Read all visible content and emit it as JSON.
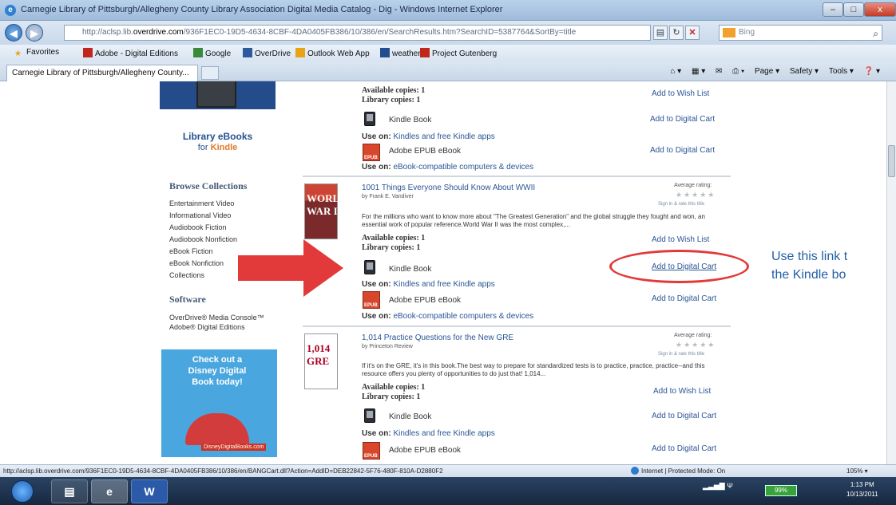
{
  "window": {
    "title": "Carnegie Library of Pittsburgh/Allegheny County Library Association Digital Media Catalog - Dig - Windows Internet Explorer",
    "minimize": "–",
    "maximize": "□",
    "close": "x"
  },
  "addressbar": {
    "url_prefix": "http://aclsp.lib.",
    "url_domain": "overdrive.com",
    "url_rest": "/936F1EC0-19D5-4634-8CBF-4DA0405FB386/10/386/en/SearchResults.htm?SearchID=5387764&SortBy=title",
    "search_placeholder": "Bing"
  },
  "favorites": {
    "label": "Favorites",
    "items": [
      "Adobe - Digital Editions",
      "Google",
      "OverDrive",
      "Outlook Web App",
      "weather",
      "Project Gutenberg"
    ]
  },
  "tab": {
    "label": "Carnegie Library of Pittsburgh/Allegheny County..."
  },
  "commandbar": {
    "page": "Page ▾",
    "safety": "Safety ▾",
    "tools": "Tools ▾"
  },
  "sidebar": {
    "kindle_ad": {
      "line1": "Library eBooks",
      "line2_prefix": "for",
      "line2_brand": "Kindle"
    },
    "browse_heading": "Browse Collections",
    "collections": [
      "Entertainment Video",
      "Informational Video",
      "Audiobook Fiction",
      "Audiobook Nonfiction",
      "eBook Fiction",
      "eBook Nonfiction",
      "Collections"
    ],
    "software_heading": "Software",
    "software": [
      "OverDrive® Media Console™",
      "Adobe® Digital Editions"
    ],
    "disney_ad": {
      "text": "Check out a Disney Digital Book today!",
      "site": "DisneyDigitalBooks.com"
    }
  },
  "results": {
    "top_partial": {
      "available_label": "Available copies:",
      "available_value": "1",
      "library_label": "Library copies:",
      "library_value": "1",
      "wish_list": "Add to Wish List",
      "kindle_format": "Kindle Book",
      "add_cart": "Add to Digital Cart",
      "use_on_label": "Use on:",
      "kindle_use_on": "Kindles and free Kindle apps",
      "epub_format": "Adobe EPUB eBook",
      "epub_use_on": "eBook-compatible computers & devices"
    },
    "item1": {
      "title": "1001 Things Everyone Should Know About WWII",
      "author": "by Frank E. Vandiver",
      "cover_text": "WORLD WAR II",
      "rating_label": "Average rating:",
      "stars": "★★★★★",
      "sign_in": "Sign in & rate this title",
      "description": "For the millions who want to know more about \"The Greatest Generation\" and the global struggle they fought and won, an essential work of popular reference.World War II was the most complex,...",
      "available_label": "Available copies:",
      "available_value": "1",
      "library_label": "Library copies:",
      "library_value": "1",
      "wish_list": "Add to Wish List",
      "kindle_format": "Kindle Book",
      "add_cart": "Add to Digital Cart",
      "use_on_label": "Use on:",
      "kindle_use_on": "Kindles and free Kindle apps",
      "epub_format": "Adobe EPUB eBook",
      "epub_use_on": "eBook-compatible computers & devices"
    },
    "item2": {
      "title": "1,014 Practice Questions for the New GRE",
      "author": "by Princeton Review",
      "cover_text": "1,014 GRE",
      "rating_label": "Average rating:",
      "stars": "★★★★★",
      "sign_in": "Sign in & rate this title",
      "description": "If it's on the GRE, it's in this book.The best way to prepare for standardized tests is to practice, practice, practice--and this resource offers you plenty of opportunities to do just that! 1,014...",
      "available_label": "Available copies:",
      "available_value": "1",
      "library_label": "Library copies:",
      "library_value": "1",
      "wish_list": "Add to Wish List",
      "kindle_format": "Kindle Book",
      "add_cart": "Add to Digital Cart",
      "use_on_label": "Use on:",
      "kindle_use_on": "Kindles and free Kindle apps",
      "epub_format": "Adobe EPUB eBook"
    }
  },
  "annotation": {
    "callout_line1": "Use this link t",
    "callout_line2": "the Kindle bo",
    "arrow_color": "#e23a3a",
    "circle_color": "#e23a3a"
  },
  "statusbar": {
    "url": "http://aclsp.lib.overdrive.com/936F1EC0-19D5-4634-8CBF-4DA0405FB386/10/386/en/BANGCart.dll?Action=AddID=DEB22842-5F76-480F-810A-D2880F2",
    "zone": "Internet | Protected Mode: On",
    "zoom": "105% ▾"
  },
  "taskbar": {
    "word_label": "W",
    "battery": "99%",
    "time": "1:13 PM",
    "date": "10/13/2011"
  }
}
